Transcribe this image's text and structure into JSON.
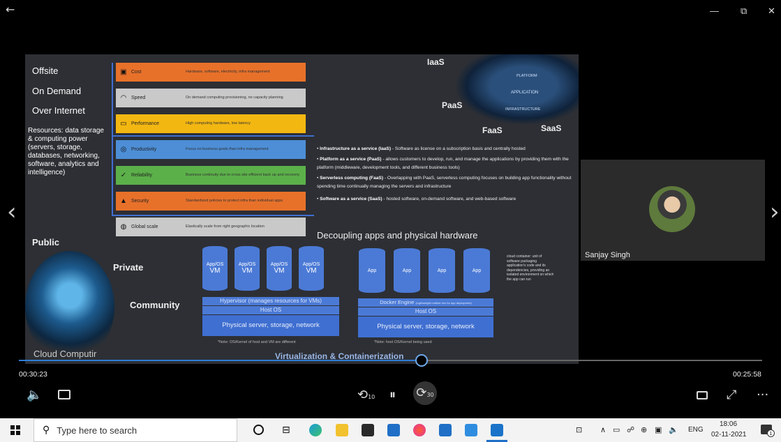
{
  "window": {
    "back_icon": "back-arrow-icon",
    "minimize": "—",
    "restore": "⧉",
    "close": "✕"
  },
  "nav": {
    "prev": "‹",
    "next": "›"
  },
  "slide": {
    "left_terms": [
      "Offsite",
      "On Demand",
      "Over Internet"
    ],
    "resources_text": "Resources: data storage & computing power (servers, storage, databases, networking, software, analytics and intelligence)",
    "categories": [
      {
        "name": "Cost",
        "desc": "Hardware, software, electricity, infra management",
        "color": "#e8712a",
        "icon": "cost-icon"
      },
      {
        "name": "Speed",
        "desc": "On demand computing provisioning, no capacity planning",
        "color": "#c9c9c9",
        "icon": "speedometer-icon"
      },
      {
        "name": "Performance",
        "desc": "High computing hardware, low latency",
        "color": "#f3b712",
        "icon": "performance-icon"
      },
      {
        "name": "Productivity",
        "desc": "Focus on business goals than infra management",
        "color": "#4d8ed6",
        "icon": "target-icon"
      },
      {
        "name": "Reliability",
        "desc": "Business continuity due to cross site efficient back up and recovery",
        "color": "#5cb04a",
        "icon": "checkmark-icon"
      },
      {
        "name": "Security",
        "desc": "Standardized policies to protect infra than individual apps",
        "color": "#e8712a",
        "icon": "lock-icon"
      },
      {
        "name": "Global scale",
        "desc": "Elastically scale from right geographic location",
        "color": "#c9c9c9",
        "icon": "globe-icon"
      }
    ],
    "service_labels": {
      "iaas": "IaaS",
      "paas": "PaaS",
      "faas": "FaaS",
      "saas": "SaaS"
    },
    "diagram_labels": [
      "PLATFORM",
      "APPLICATION",
      "INFRASTRUCTURE"
    ],
    "services": [
      {
        "term": "Infrastructure as a service (IaaS)",
        "text": " - Software as license on a subscription basis and centrally hosted"
      },
      {
        "term": "Platform as a service (PaaS)",
        "text": " - allows customers to develop, run, and manage the applications by providing them with the platform (middleware, development tools, and different business tools)"
      },
      {
        "term": "Serverless computing (FaaS)",
        "text": " - Overlapping with PaaS, serverless computing focuses on building app functionality without spending time continually managing the servers and infrastructure"
      },
      {
        "term": "Software as a service (SaaS)",
        "text": " - hosted software, on-demand software, and web-based software"
      }
    ],
    "deploy_labels": {
      "public": "Public",
      "private": "Private",
      "community": "Community",
      "cloud": "Cloud Computir"
    },
    "decoupling_title": "Decoupling apps and physical hardware",
    "vm_stack": {
      "vms": [
        "App/OS VM",
        "App/OS VM",
        "App/OS VM",
        "App/OS VM"
      ],
      "vm_top": "App/OS",
      "vm_bottom": "VM",
      "hypervisor": "Hypervisor (manages resources for VMs)",
      "host_os": "Host OS",
      "server": "Physical server, storage, network",
      "note": "*Note: OS/Kernel of host and VM are different"
    },
    "container_stack": {
      "apps": [
        "App",
        "App",
        "App",
        "App"
      ],
      "engine": "Docker Engine",
      "engine_note": "(Lightweight runtime env for app deployment)",
      "host_os": "Host OS",
      "server": "Physical server, storage, network",
      "note": "*Note: host OS/Kernel being used"
    },
    "container_def": "cloud container: unit of software packaging application's code and its dependencies, providing an isolated environment on which the app can run",
    "footer_title": "Virtualization & Containerization"
  },
  "participant": {
    "name": "Sanjay Singh"
  },
  "player": {
    "elapsed": "00:30:23",
    "remaining": "00:25:58",
    "progress": 0.542,
    "volume_icon": "🔈",
    "captions_icon": "captions-icon",
    "rewind_label": "10",
    "pause_label": "⏸",
    "forward_label": "30",
    "more_label": "···"
  },
  "taskbar": {
    "search_placeholder": "Type here to search",
    "language": "ENG",
    "time": "18:06",
    "date": "02-11-2021",
    "notifications": "1"
  }
}
